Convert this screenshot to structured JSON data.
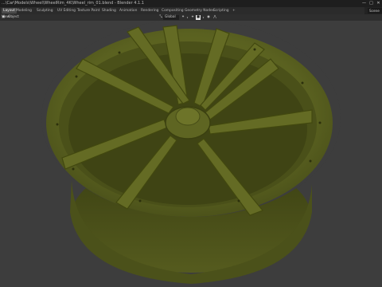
{
  "window": {
    "title": "...\\Car\\Models\\Wheel\\WheelRim_4K\\Wheel_rim_01.blend - Blender 4.1.1",
    "controls": [
      "—",
      "□",
      "✕"
    ]
  },
  "topbar": {
    "tabs": [
      {
        "label": "Layout",
        "active": true
      },
      {
        "label": "Modeling"
      },
      {
        "label": "Sculpting"
      },
      {
        "label": "UV Editing"
      },
      {
        "label": "Texture Paint"
      },
      {
        "label": "Shading"
      },
      {
        "label": "Animation"
      },
      {
        "label": "Rendering"
      },
      {
        "label": "Compositing"
      },
      {
        "label": "Geometry Nodes"
      },
      {
        "label": "Scripting"
      },
      {
        "label": "+"
      }
    ],
    "scene": "Scene"
  },
  "toolbar": {
    "mode": "Object Mode",
    "menu": [
      "View",
      "Select",
      "Add",
      "Object"
    ],
    "transform_orientation": "Global",
    "icons": [
      "orientation-icon",
      "pivot-icon",
      "snap-icon",
      "snap-target-icon",
      "proportional-icon",
      "falloff-icon"
    ]
  },
  "viewport": {
    "object_color": "#5c6322",
    "background_color": "#3d3d3d"
  }
}
